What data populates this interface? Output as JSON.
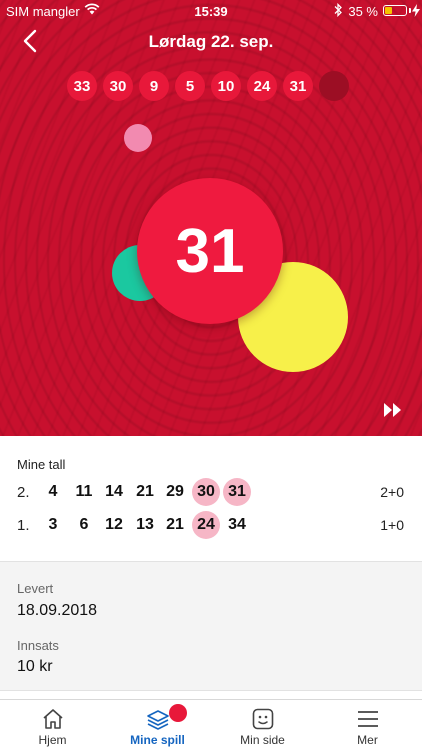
{
  "status_bar": {
    "carrier": "SIM mangler",
    "time": "15:39",
    "battery_percent": "35 %",
    "battery_level": 0.35,
    "battery_color": "#f5c400"
  },
  "header": {
    "title": "Lørdag 22. sep.",
    "back_icon": "chevron-left-icon"
  },
  "drawn_balls": [
    "33",
    "30",
    "9",
    "5",
    "10",
    "24",
    "31"
  ],
  "drawn_balls_pending": 1,
  "current_ball": "31",
  "animation_colors": {
    "background": "#c8102e",
    "current_ball": "#ef1a3f",
    "pink": "#f28ab0",
    "teal": "#1bc8a0",
    "yellow": "#f7f04a",
    "hit_highlight": "#f6b6c6"
  },
  "skip_icon": "fast-forward-icon",
  "my_numbers": {
    "label": "Mine tall",
    "rows": [
      {
        "index": "2.",
        "numbers": [
          {
            "n": "4",
            "hit": false
          },
          {
            "n": "11",
            "hit": false
          },
          {
            "n": "14",
            "hit": false
          },
          {
            "n": "21",
            "hit": false
          },
          {
            "n": "29",
            "hit": false
          },
          {
            "n": "30",
            "hit": true
          },
          {
            "n": "31",
            "hit": true
          }
        ],
        "score": "2+0"
      },
      {
        "index": "1.",
        "numbers": [
          {
            "n": "3",
            "hit": false
          },
          {
            "n": "6",
            "hit": false
          },
          {
            "n": "12",
            "hit": false
          },
          {
            "n": "13",
            "hit": false
          },
          {
            "n": "21",
            "hit": false
          },
          {
            "n": "24",
            "hit": true
          },
          {
            "n": "34",
            "hit": false
          }
        ],
        "score": "1+0"
      }
    ]
  },
  "details": {
    "delivered_label": "Levert",
    "delivered_value": "18.09.2018",
    "stake_label": "Innsats",
    "stake_value": "10 kr"
  },
  "tabs": [
    {
      "label": "Hjem",
      "icon": "home-icon",
      "active": false
    },
    {
      "label": "Mine spill",
      "icon": "stacked-tickets-icon",
      "active": true,
      "badge": true
    },
    {
      "label": "Min side",
      "icon": "smiley-face-icon",
      "active": false
    },
    {
      "label": "Mer",
      "icon": "menu-icon",
      "active": false
    }
  ],
  "accent_color": "#1565c0"
}
